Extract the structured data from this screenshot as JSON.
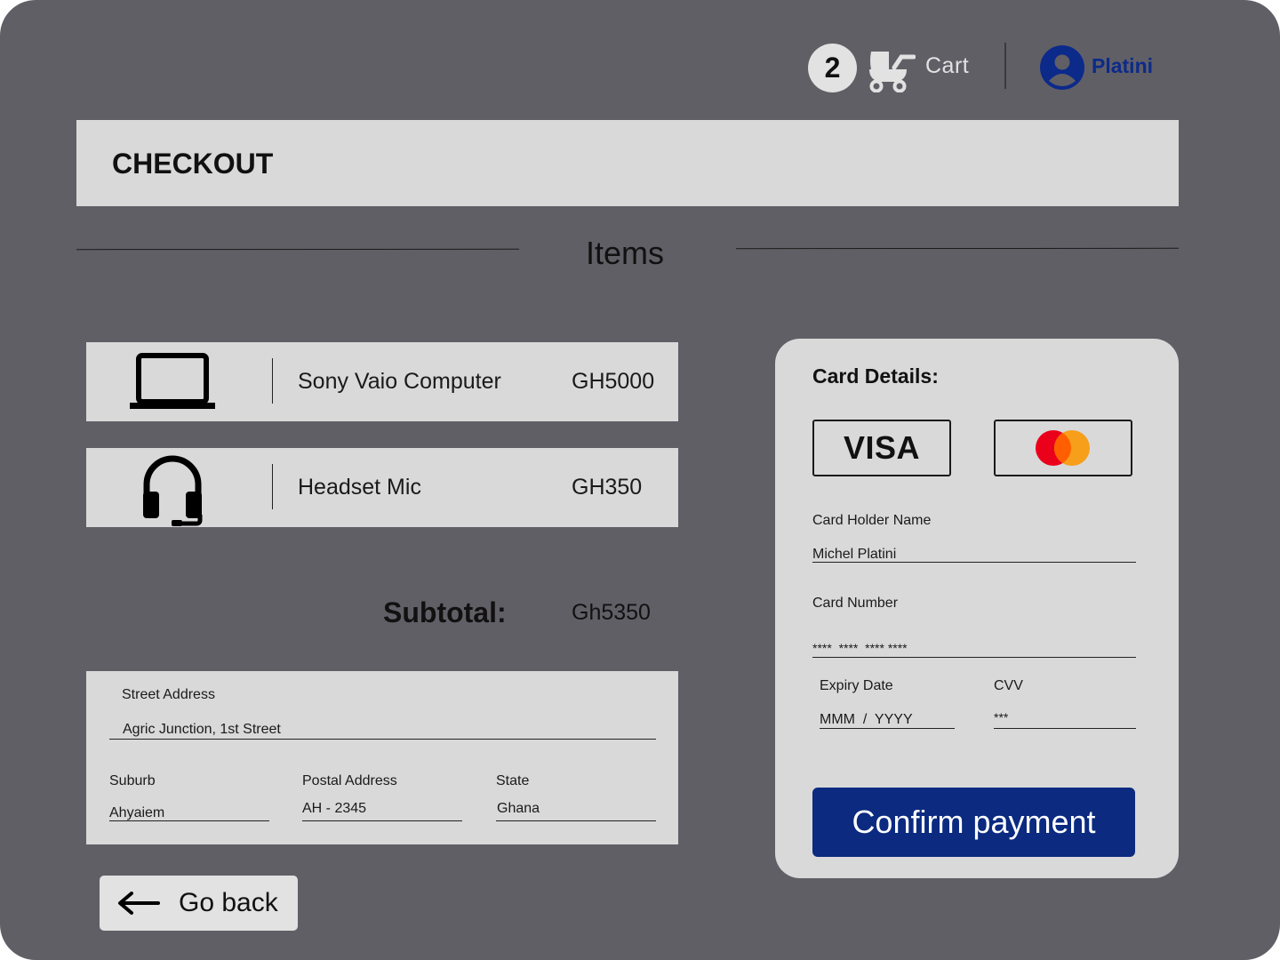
{
  "header": {
    "cart_count": "2",
    "cart_label": "Cart",
    "user_name": "Platini"
  },
  "page": {
    "title": "CHECKOUT",
    "items_heading": "Items"
  },
  "items": [
    {
      "icon": "laptop-icon",
      "name": "Sony Vaio Computer",
      "price": "GH5000"
    },
    {
      "icon": "headset-icon",
      "name": "Headset Mic",
      "price": "GH350"
    }
  ],
  "subtotal": {
    "label": "Subtotal:",
    "value": "Gh5350"
  },
  "address": {
    "street_label": "Street Address",
    "street_value": "Agric Junction, 1st Street",
    "suburb_label": "Suburb",
    "suburb_value": "Ahyaiem",
    "postal_label": "Postal Address",
    "postal_value": "AH - 2345",
    "state_label": "State",
    "state_value": "Ghana"
  },
  "go_back_label": "Go back",
  "card": {
    "title": "Card Details:",
    "visa_label": "VISA",
    "holder_label": "Card Holder Name",
    "holder_value": "Michel Platini",
    "number_label": "Card Number",
    "number_value": "****  ****  **** ****",
    "expiry_label": "Expiry Date",
    "expiry_value": "MMM  /  YYYY",
    "cvv_label": "CVV",
    "cvv_value": "***",
    "confirm_label": "Confirm payment"
  },
  "colors": {
    "background": "#615f66",
    "panel": "#d9d9d9",
    "accent": "#0b2a80",
    "mastercard_red": "#eb001b",
    "mastercard_orange": "#f79e1b"
  }
}
